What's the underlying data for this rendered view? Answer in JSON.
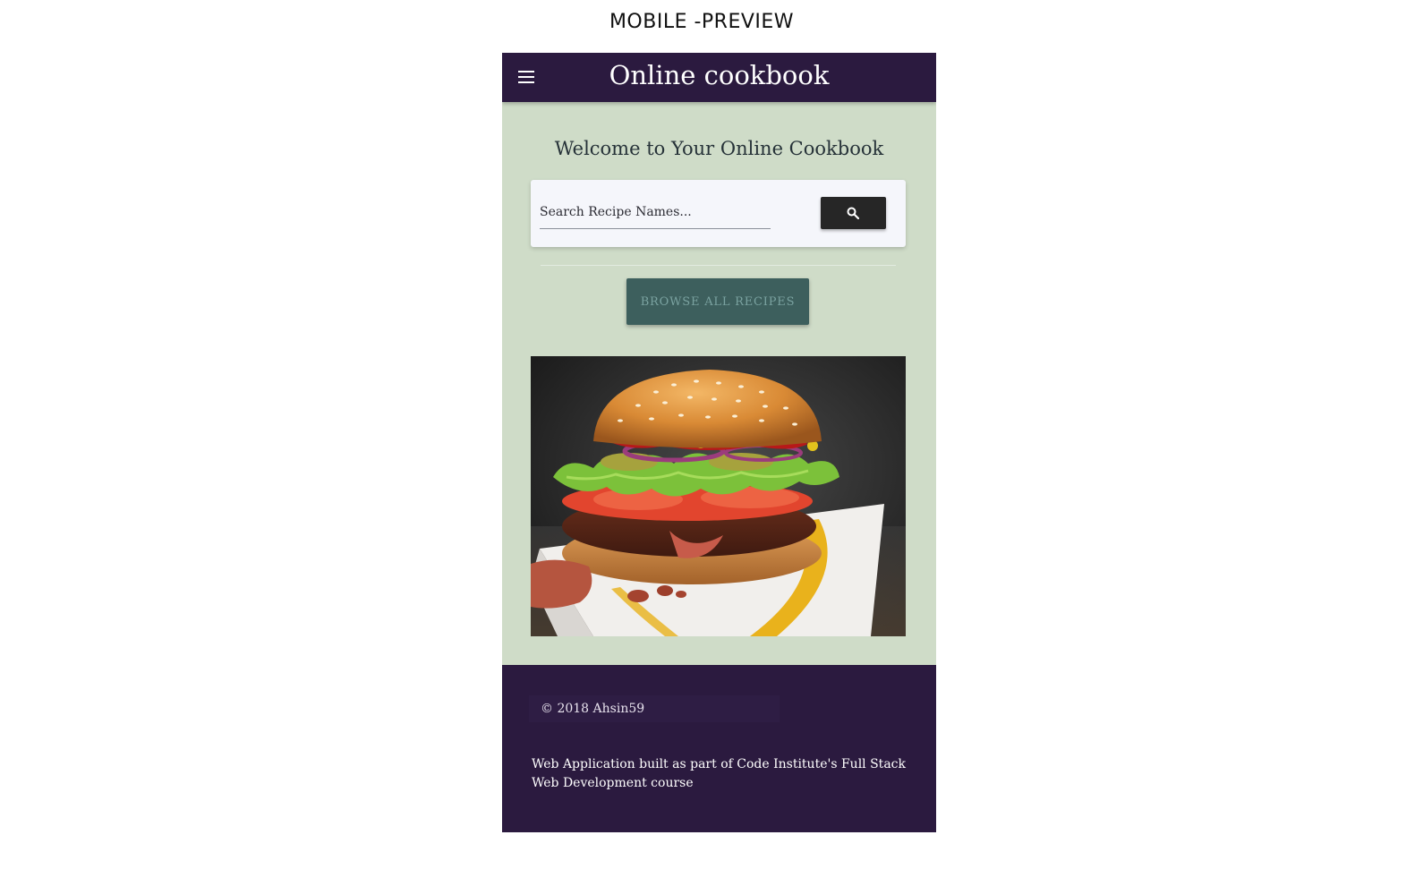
{
  "caption": "MOBILE -PREVIEW",
  "navbar": {
    "brand": "Online cookbook",
    "menu_icon": "hamburger-menu-icon",
    "background": "#2b1a3f"
  },
  "main": {
    "welcome": "Welcome to Your Online Cookbook",
    "search": {
      "placeholder": "Search Recipe Names...",
      "value": "",
      "button_icon": "search-icon"
    },
    "browse_label": "BROWSE ALL RECIPES",
    "hero_image": "burger-photo",
    "background": "#cfdcc8"
  },
  "footer": {
    "copyright": "© 2018 Ahsin59",
    "note": "Web Application built as part of Code Institute's Full Stack Web Development course"
  }
}
